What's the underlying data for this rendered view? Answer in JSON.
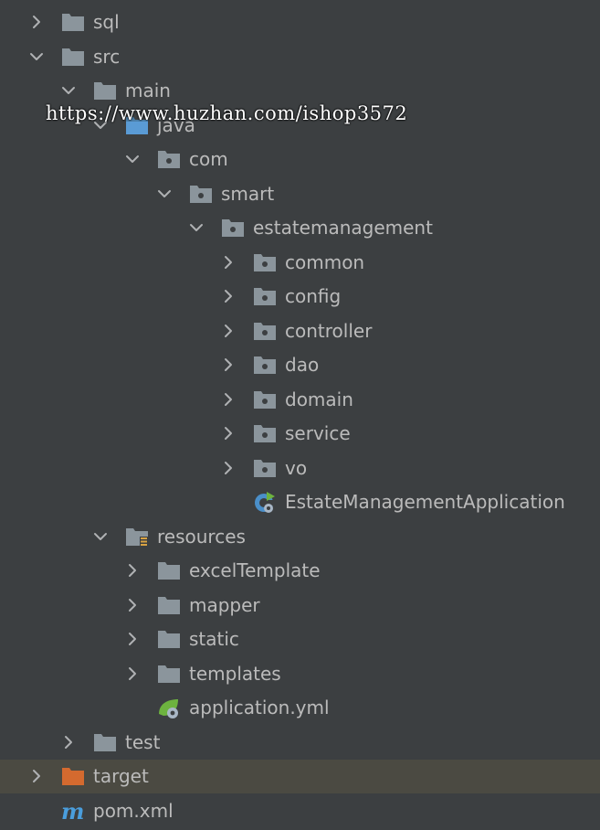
{
  "project_tree": {
    "nodes": [
      {
        "label": "sql",
        "icon": "folder-icon",
        "depth": 0,
        "state": "collapsed"
      },
      {
        "label": "src",
        "icon": "folder-icon",
        "depth": 0,
        "state": "expanded"
      },
      {
        "label": "main",
        "icon": "folder-icon",
        "depth": 1,
        "state": "expanded"
      },
      {
        "label": "java",
        "icon": "source-root-folder-icon",
        "depth": 2,
        "state": "expanded"
      },
      {
        "label": "com",
        "icon": "package-icon",
        "depth": 3,
        "state": "expanded"
      },
      {
        "label": "smart",
        "icon": "package-icon",
        "depth": 4,
        "state": "expanded"
      },
      {
        "label": "estatemanagement",
        "icon": "package-icon",
        "depth": 5,
        "state": "expanded"
      },
      {
        "label": "common",
        "icon": "package-icon",
        "depth": 6,
        "state": "collapsed"
      },
      {
        "label": "config",
        "icon": "package-icon",
        "depth": 6,
        "state": "collapsed"
      },
      {
        "label": "controller",
        "icon": "package-icon",
        "depth": 6,
        "state": "collapsed"
      },
      {
        "label": "dao",
        "icon": "package-icon",
        "depth": 6,
        "state": "collapsed"
      },
      {
        "label": "domain",
        "icon": "package-icon",
        "depth": 6,
        "state": "collapsed"
      },
      {
        "label": "service",
        "icon": "package-icon",
        "depth": 6,
        "state": "collapsed"
      },
      {
        "label": "vo",
        "icon": "package-icon",
        "depth": 6,
        "state": "collapsed"
      },
      {
        "label": "EstateManagementApplication",
        "icon": "spring-boot-class-icon",
        "depth": 6,
        "state": "leaf"
      },
      {
        "label": "resources",
        "icon": "resources-folder-icon",
        "depth": 2,
        "state": "expanded"
      },
      {
        "label": "excelTemplate",
        "icon": "folder-icon",
        "depth": 3,
        "state": "collapsed"
      },
      {
        "label": "mapper",
        "icon": "folder-icon",
        "depth": 3,
        "state": "collapsed"
      },
      {
        "label": "static",
        "icon": "folder-icon",
        "depth": 3,
        "state": "collapsed"
      },
      {
        "label": "templates",
        "icon": "folder-icon",
        "depth": 3,
        "state": "collapsed"
      },
      {
        "label": "application.yml",
        "icon": "spring-yaml-file-icon",
        "depth": 3,
        "state": "leaf"
      },
      {
        "label": "test",
        "icon": "folder-icon",
        "depth": 1,
        "state": "collapsed"
      },
      {
        "label": "target",
        "icon": "excluded-folder-icon",
        "depth": 0,
        "state": "collapsed",
        "selected": true
      },
      {
        "label": "pom.xml",
        "icon": "maven-file-icon",
        "depth": 0,
        "state": "leaf"
      }
    ]
  },
  "watermark": {
    "text": "https://www.huzhan.com/ishop3572"
  },
  "colors": {
    "background": "#3c3f41",
    "text": "#bbbbbb",
    "folder": "#8b959c",
    "excluded_folder": "#d46a2f",
    "selected_row": "#4b4a42",
    "maven": "#4a9edd",
    "spring_green": "#6db33f"
  }
}
